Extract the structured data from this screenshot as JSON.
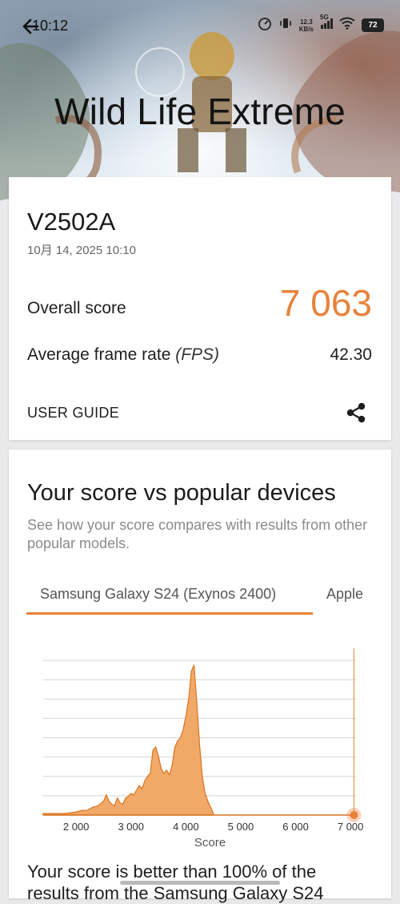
{
  "status_bar": {
    "time": "10:12",
    "net_speed_top": "12.3",
    "net_speed_bottom": "KB/s",
    "network": "5G",
    "battery": "72"
  },
  "hero": {
    "title": "Wild Life Extreme"
  },
  "result": {
    "device": "V2502A",
    "date": "10月 14, 2025 10:10",
    "overall_label": "Overall score",
    "overall_value": "7 063",
    "fps_label": "Average frame rate",
    "fps_unit": "(FPS)",
    "fps_value": "42.30",
    "user_guide": "USER GUIDE"
  },
  "comparison": {
    "title": "Your score vs popular devices",
    "subtitle": "See how your score compares with results from other popular models.",
    "tabs": [
      "Samsung Galaxy S24 (Exynos 2400)",
      "Apple"
    ],
    "active_tab": 0,
    "verdict_line1": "Your score is better than 100% of the",
    "verdict_line2": "results from the Samsung Galaxy S24"
  },
  "colors": {
    "accent": "#e8823b",
    "histogram_fill": "#f1a968",
    "histogram_stroke": "#d9731f"
  },
  "chart_data": {
    "type": "area",
    "xlabel": "Score",
    "x_ticks": [
      2000,
      3000,
      4000,
      5000,
      6000,
      7000
    ],
    "x_tick_labels": [
      "2 000",
      "3 000",
      "4 000",
      "5 000",
      "6 000",
      "7 000"
    ],
    "xlim": [
      1400,
      7100
    ],
    "ylim": [
      0,
      100
    ],
    "grid": true,
    "marker_score": 7063,
    "x": [
      1400,
      1600,
      1800,
      2000,
      2100,
      2200,
      2300,
      2400,
      2500,
      2550,
      2600,
      2650,
      2700,
      2750,
      2800,
      2850,
      2900,
      2950,
      3000,
      3050,
      3100,
      3150,
      3200,
      3250,
      3300,
      3350,
      3400,
      3450,
      3500,
      3550,
      3600,
      3650,
      3700,
      3750,
      3800,
      3850,
      3900,
      3950,
      4000,
      4050,
      4100,
      4150,
      4200,
      4250,
      4300,
      4350,
      4400,
      4450,
      4500
    ],
    "y": [
      1,
      1,
      1,
      2,
      3,
      3,
      5,
      6,
      9,
      13,
      9,
      7,
      6,
      11,
      8,
      7,
      11,
      12,
      14,
      13,
      16,
      19,
      17,
      22,
      25,
      27,
      42,
      44,
      38,
      30,
      27,
      29,
      26,
      32,
      44,
      48,
      50,
      55,
      64,
      75,
      93,
      97,
      72,
      45,
      25,
      14,
      9,
      5,
      1
    ]
  }
}
